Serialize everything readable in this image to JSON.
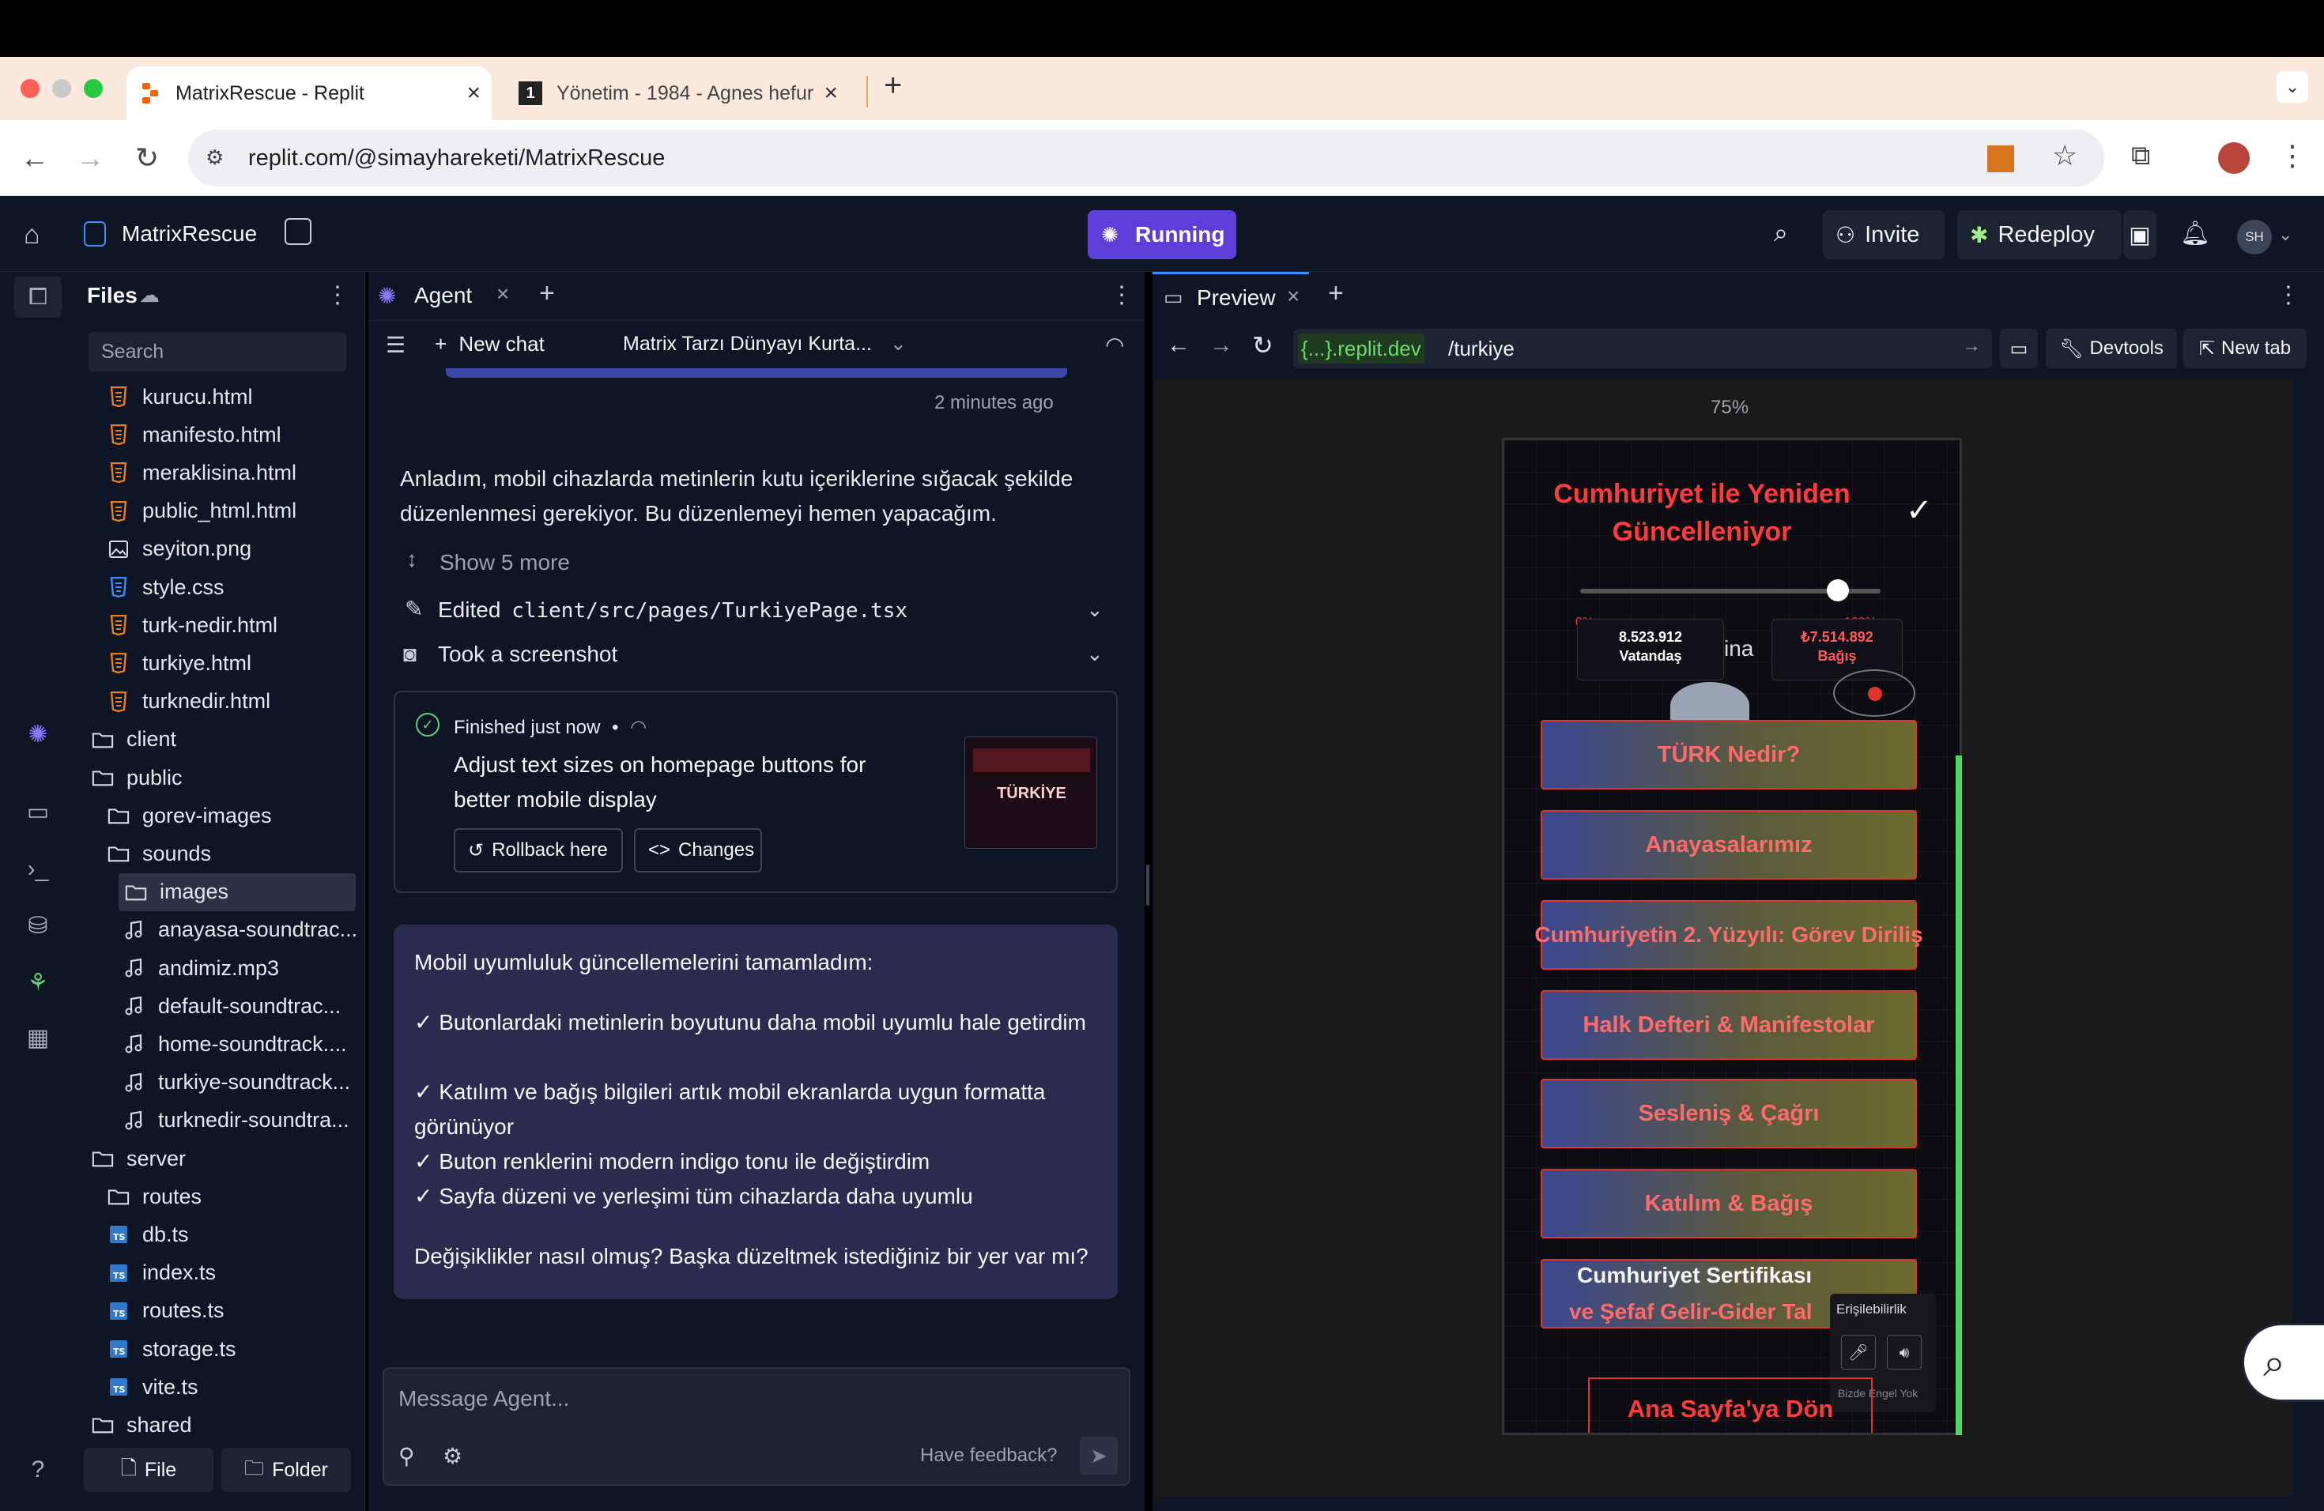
{
  "browser": {
    "tabs": [
      {
        "title": "MatrixRescue - Replit"
      },
      {
        "title": "Yönetim - 1984 - Agnes hefur"
      }
    ],
    "address": "replit.com/@simayhareketi/MatrixRescue"
  },
  "header": {
    "project_name": "MatrixRescue",
    "run_status": "Running",
    "invite_label": "Invite",
    "redeploy_label": "Redeploy",
    "avatar_initials": "SH"
  },
  "files": {
    "title": "Files",
    "search_placeholder": "Search",
    "items": [
      {
        "name": "kurucu.html",
        "type": "html"
      },
      {
        "name": "manifesto.html",
        "type": "html"
      },
      {
        "name": "meraklisina.html",
        "type": "html"
      },
      {
        "name": "public_html.html",
        "type": "html"
      },
      {
        "name": "seyiton.png",
        "type": "image"
      },
      {
        "name": "style.css",
        "type": "css"
      },
      {
        "name": "turk-nedir.html",
        "type": "html"
      },
      {
        "name": "turkiye.html",
        "type": "html"
      },
      {
        "name": "turknedir.html",
        "type": "html"
      },
      {
        "name": "client",
        "type": "folder"
      },
      {
        "name": "public",
        "type": "folder"
      },
      {
        "name": "gorev-images",
        "type": "folder"
      },
      {
        "name": "sounds",
        "type": "folder"
      },
      {
        "name": "images",
        "type": "folder"
      },
      {
        "name": "anayasa-soundtrac...",
        "type": "audio"
      },
      {
        "name": "andimiz.mp3",
        "type": "audio"
      },
      {
        "name": "default-soundtrac...",
        "type": "audio"
      },
      {
        "name": "home-soundtrack....",
        "type": "audio"
      },
      {
        "name": "turkiye-soundtrack...",
        "type": "audio"
      },
      {
        "name": "turknedir-soundtra...",
        "type": "audio"
      },
      {
        "name": "server",
        "type": "folder"
      },
      {
        "name": "routes",
        "type": "folder"
      },
      {
        "name": "db.ts",
        "type": "ts"
      },
      {
        "name": "index.ts",
        "type": "ts"
      },
      {
        "name": "routes.ts",
        "type": "ts"
      },
      {
        "name": "storage.ts",
        "type": "ts"
      },
      {
        "name": "vite.ts",
        "type": "ts"
      },
      {
        "name": "shared",
        "type": "folder"
      }
    ],
    "new_file_label": "File",
    "new_folder_label": "Folder"
  },
  "agent": {
    "tab_label": "Agent",
    "new_chat_label": "New chat",
    "chat_title": "Matrix Tarzı Dünyayı Kurta...",
    "timestamp": "2 minutes ago",
    "intro": "Anladım, mobil cihazlarda metinlerin kutu içeriklerine sığacak şekilde düzenlenmesi gerekiyor. Bu düzenlemeyi hemen yapacağım.",
    "show_more": "Show 5 more",
    "edited_prefix": "Edited",
    "edited_path": "client/src/pages/TurkiyePage.tsx",
    "screenshot_label": "Took a screenshot",
    "finished_label": "Finished just now",
    "checkpoint_title": "Adjust text sizes on homepage buttons for better mobile display",
    "rollback_label": "Rollback here",
    "changes_label": "Changes",
    "thumb_text": "TÜRKİYE",
    "response_lines": [
      "Mobil uyumluluk güncellemelerini tamamladım:",
      "✓ Butonlardaki metinlerin boyutunu daha mobil uyumlu hale getirdim",
      "✓ Katılım ve bağış bilgileri artık mobil ekranlarda uygun formatta görünüyor",
      "✓ Buton renklerini modern indigo tonu ile değiştirdim",
      "✓ Sayfa düzeni ve yerleşimi tüm cihazlarda daha uyumlu",
      "Değişiklikler nasıl olmuş? Başka düzeltmek istediğiniz bir yer var mı?"
    ],
    "composer_placeholder": "Message Agent...",
    "feedback_label": "Have feedback?"
  },
  "preview": {
    "tab_label": "Preview",
    "domain": "{...}.replit.dev",
    "path": "/turkiye",
    "devtools_label": "Devtools",
    "newtab_label": "New tab",
    "zoom": "75%",
    "phone": {
      "title": "Cumhuriyet ile Yeniden Güncelleniyor",
      "slider_min": "0%",
      "slider_max": "100%",
      "slider_value_percent": 92,
      "stat_left_value": "8.523.912",
      "stat_left_label": "Vatandaş",
      "stat_right_value": "₺7.514.892",
      "stat_right_label": "Bağış",
      "stat_mid_fragment": "ina",
      "buttons": [
        "TÜRK Nedir?",
        "Anayasalarımız",
        "Cumhuriyetin 2. Yüzyılı: Görev Diriliş",
        "Halk Defteri & Manifestolar",
        "Sesleniş & Çağrı",
        "Katılım & Bağış"
      ],
      "cert_line1": "Cumhuriyet Sertifikası",
      "cert_line2": "ve Şefaf Gelir-Gider Tal",
      "accessibility_label": "Erişilebilirlik",
      "accessibility_footer": "Bizde Engel Yok",
      "home_button": "Ana Sayfa'ya Dön"
    }
  },
  "colors": {
    "bg_dark": "#0e1525",
    "running": "#5b3fd6",
    "message_bg": "#2a2b4e",
    "accent_red": "#ff3b3b",
    "progress_green": "#4cd964"
  }
}
